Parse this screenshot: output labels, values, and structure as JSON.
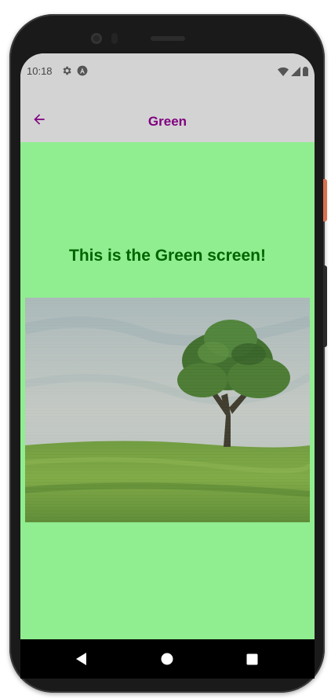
{
  "status_bar": {
    "time": "10:18",
    "icons": [
      "gear-icon",
      "a-icon",
      "wifi-icon",
      "signal-icon",
      "battery-icon"
    ]
  },
  "app_bar": {
    "title": "Green",
    "back_icon": "arrow-left-icon"
  },
  "content": {
    "headline": "This is the Green screen!",
    "image_alt": "tree-on-grassy-hill"
  },
  "nav_bar": {
    "buttons": [
      "back-triangle-icon",
      "home-circle-icon",
      "recents-square-icon"
    ]
  },
  "colors": {
    "accent": "#800080",
    "background": "#90ee90",
    "headline": "#006400",
    "bar": "#d3d3d3"
  }
}
